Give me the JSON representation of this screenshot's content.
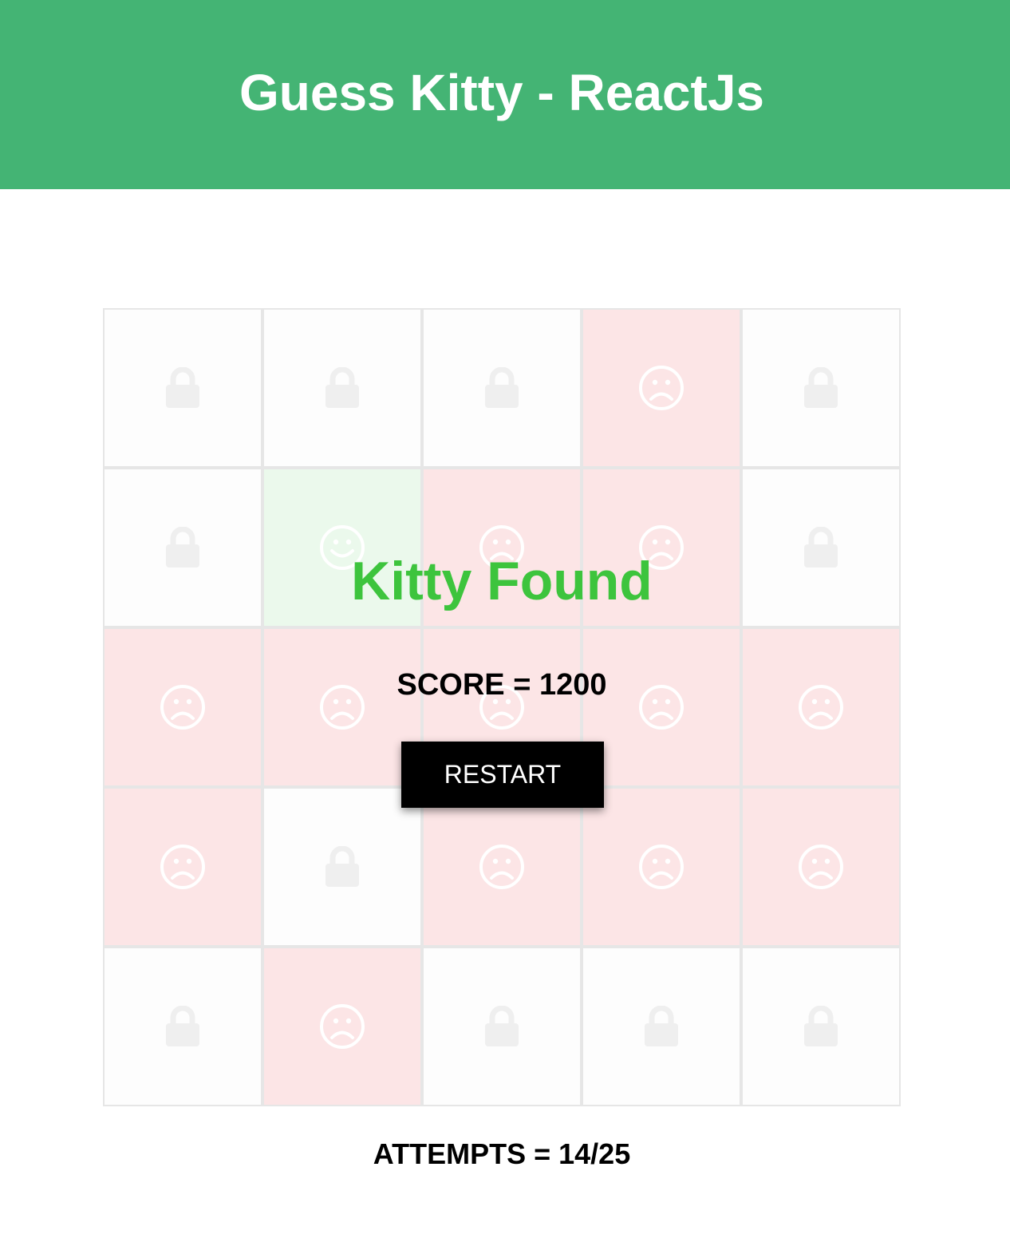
{
  "header": {
    "title": "Guess Kitty - ReactJs",
    "background": "#44b474"
  },
  "board": {
    "rows": 5,
    "cols": 5,
    "tiles": [
      "locked",
      "locked",
      "locked",
      "miss",
      "locked",
      "locked",
      "hit",
      "miss",
      "miss",
      "locked",
      "miss",
      "miss",
      "miss",
      "miss",
      "miss",
      "miss",
      "locked",
      "miss",
      "miss",
      "miss",
      "locked",
      "miss",
      "locked",
      "locked",
      "locked"
    ],
    "state_icons": {
      "locked": "lock-icon",
      "miss": "sad-face-icon",
      "hit": "happy-face-icon"
    },
    "state_colors": {
      "locked": "#fdfdfd",
      "miss": "#fce5e6",
      "hit": "#ebf9ec"
    }
  },
  "result": {
    "title": "Kitty Found",
    "title_color": "#3dc43d",
    "score_text": "SCORE = 1200",
    "restart_label": "RESTART"
  },
  "status": {
    "attempts_text": "ATTEMPTS = 14/25"
  }
}
